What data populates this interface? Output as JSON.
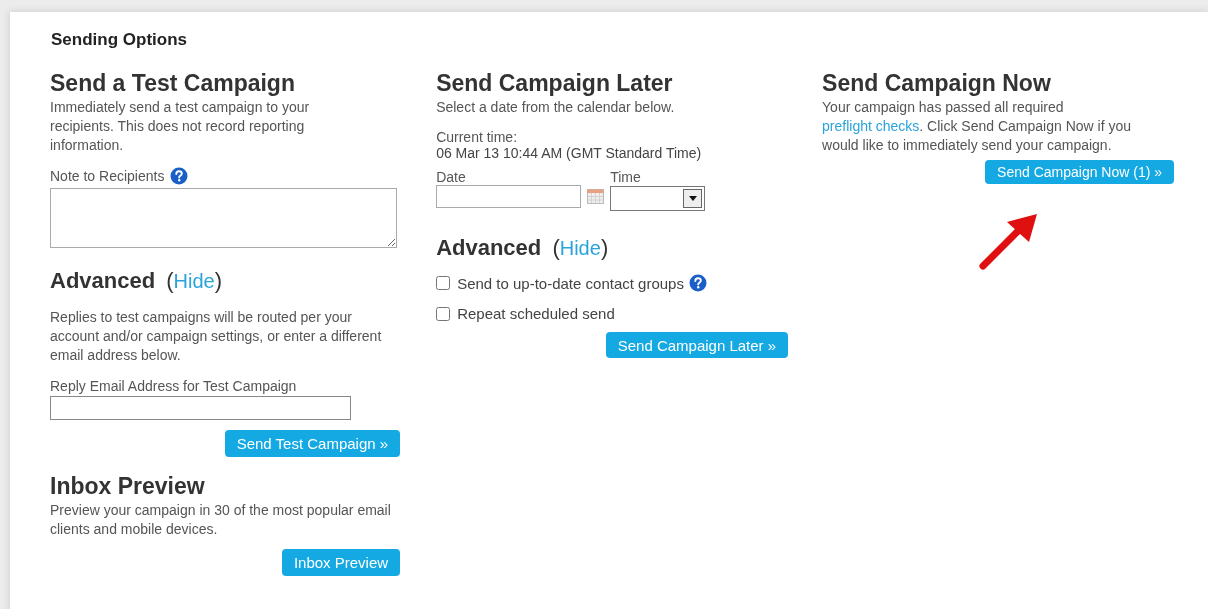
{
  "panel": {
    "title": "Sending Options"
  },
  "test_campaign": {
    "title": "Send a Test Campaign",
    "description": "Immediately send a test campaign to your recipients. This does not record reporting information.",
    "note_label": "Note to Recipients",
    "advanced": {
      "title": "Advanced",
      "open_paren": "(",
      "link": "Hide",
      "close_paren": ")"
    },
    "advanced_text": "Replies to test campaigns will be routed per your account and/or campaign settings, or enter a different email address below.",
    "reply_label": "Reply Email Address for Test Campaign",
    "button": "Send Test Campaign »"
  },
  "inbox_preview": {
    "title": "Inbox Preview",
    "description": "Preview your campaign in 30 of the most popular email clients and mobile devices.",
    "button": "Inbox Preview"
  },
  "send_later": {
    "title": "Send Campaign Later",
    "description": "Select a date from the calendar below.",
    "current_time_label": "Current time:",
    "current_time": "06 Mar 13 10:44 AM (GMT Standard Time)",
    "date_label": "Date",
    "time_label": "Time",
    "advanced": {
      "title": "Advanced",
      "open_paren": "(",
      "link": "Hide",
      "close_paren": ")"
    },
    "options": [
      {
        "label": "Send to up-to-date contact groups",
        "checked": false,
        "help": true
      },
      {
        "label": "Repeat scheduled send",
        "checked": false,
        "help": false
      }
    ],
    "button": "Send Campaign Later »"
  },
  "send_now": {
    "title": "Send Campaign Now",
    "text_before": "Your campaign has passed all required ",
    "link": "preflight checks",
    "text_after": ". Click Send Campaign Now if you would like to immediately send your campaign.",
    "button": "Send Campaign Now (1) »"
  }
}
